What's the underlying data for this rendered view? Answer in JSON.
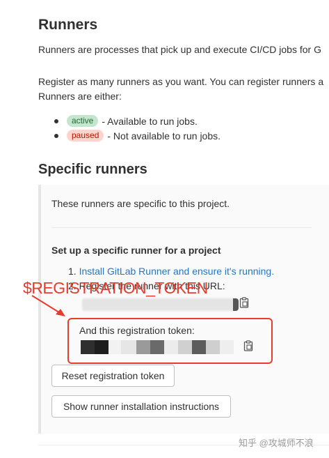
{
  "page": {
    "title": "Runners",
    "intro_line": "Runners are processes that pick up and execute CI/CD jobs for G",
    "register_line1": "Register as many runners as you want. You can register runners a",
    "register_line2": "Runners are either:",
    "states": [
      {
        "badge": "active",
        "text": "- Available to run jobs."
      },
      {
        "badge": "paused",
        "text": "- Not available to run jobs."
      }
    ]
  },
  "specific_runners": {
    "title": "Specific runners",
    "description": "These runners are specific to this project.",
    "setup_title": "Set up a specific runner for a project",
    "step1_number": "1.",
    "step1_link": "Install GitLab Runner and ensure it's running.",
    "step2": "2. Register the runner with this URL:",
    "token_label": "And this registration token:",
    "reset_button": "Reset registration token",
    "instructions_button": "Show runner installation instructions"
  },
  "annotation": {
    "text": "$REGISTRATION_TOKEN",
    "color": "#e53c2c"
  },
  "watermark": "知乎 @攻城师不浪",
  "icons": {
    "copy_url": "clipboard-icon",
    "copy_token": "clipboard-icon",
    "arrow": "arrow-icon"
  },
  "colors": {
    "link": "#1f75cb",
    "active_badge_bg": "#c3e6cd",
    "active_badge_fg": "#24663b",
    "paused_badge_bg": "#fdd4cd",
    "paused_badge_fg": "#ae1800"
  }
}
